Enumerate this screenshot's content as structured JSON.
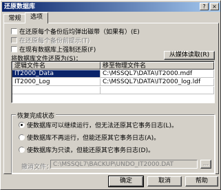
{
  "window": {
    "title": "还原数据库",
    "help_btn": "?",
    "close_btn": "×"
  },
  "tabs": [
    {
      "label": "常规"
    },
    {
      "label": "选项"
    }
  ],
  "options": {
    "checkbox_1": "在还原每个备份后均弹出磁带（如果有）(E)",
    "checkbox_2": "在还原每个备份前提示(T)",
    "checkbox_3": "在现有数据库上强制还原(F)"
  },
  "restore_as_label": "将数据库文件还原为(S)：",
  "from_media_button": "从媒体读取(R)",
  "file_grid": {
    "columns": [
      "逻辑文件名",
      "移至物理文件名"
    ],
    "rows": [
      [
        "IT2000_Data",
        "C:\\MSSQL7\\DATA\\IT2000.mdf"
      ],
      [
        "IT2000_Log",
        "C:\\MSSQL7\\DATA\\IT2000_log.ldf"
      ]
    ]
  },
  "recovery": {
    "title": "恢复完成状态",
    "option_1": "使数据库可以继续运行，但无法还原其它事务日志(L)。",
    "option_2": "使数据库不再运行，但能还原其它事务日志(A)。",
    "option_3": "使数据库为只读，但能还原其它事务日志(D)。",
    "undo_label": "撤消文件：",
    "undo_path": "C:\\MSSQL7\\BACKUP\\UNDO_IT2000.DAT",
    "browse_button": "..."
  },
  "footer": {
    "ok": "确定",
    "cancel": "取消",
    "help": "帮助"
  }
}
